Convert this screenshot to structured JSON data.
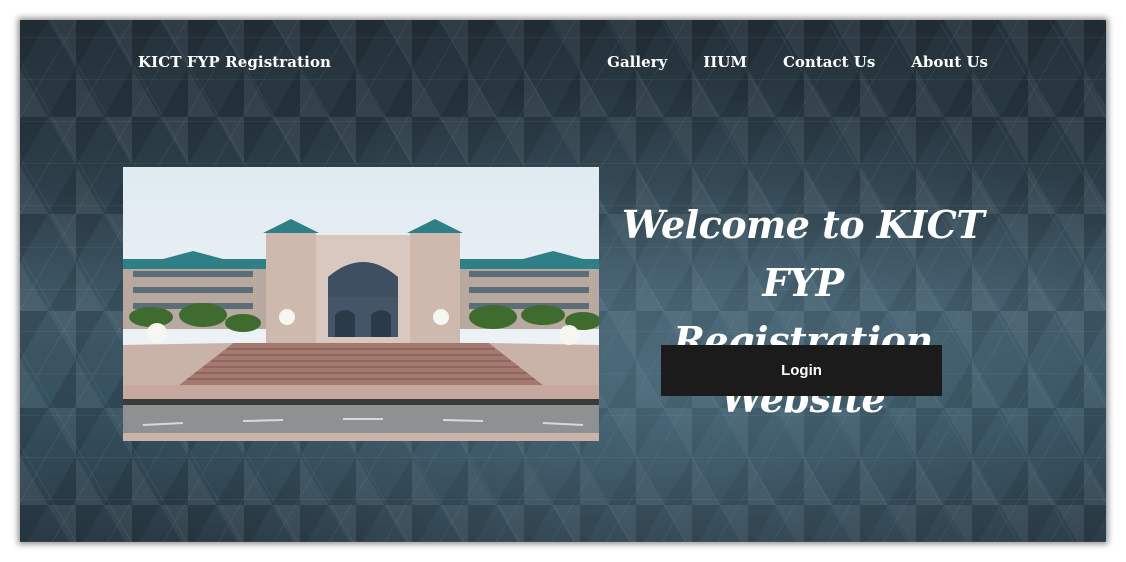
{
  "header": {
    "brand": "KICT FYP Registration",
    "nav": [
      "Gallery",
      "IIUM",
      "Contact Us",
      "About Us"
    ]
  },
  "hero": {
    "title_line1": "Welcome to KICT FYP",
    "title_line2": "Registration Website",
    "login_label": "Login",
    "image": "building-photo"
  },
  "colors": {
    "background": "#2f424e",
    "button": "#1b1b1b",
    "text": "#ffffff"
  }
}
